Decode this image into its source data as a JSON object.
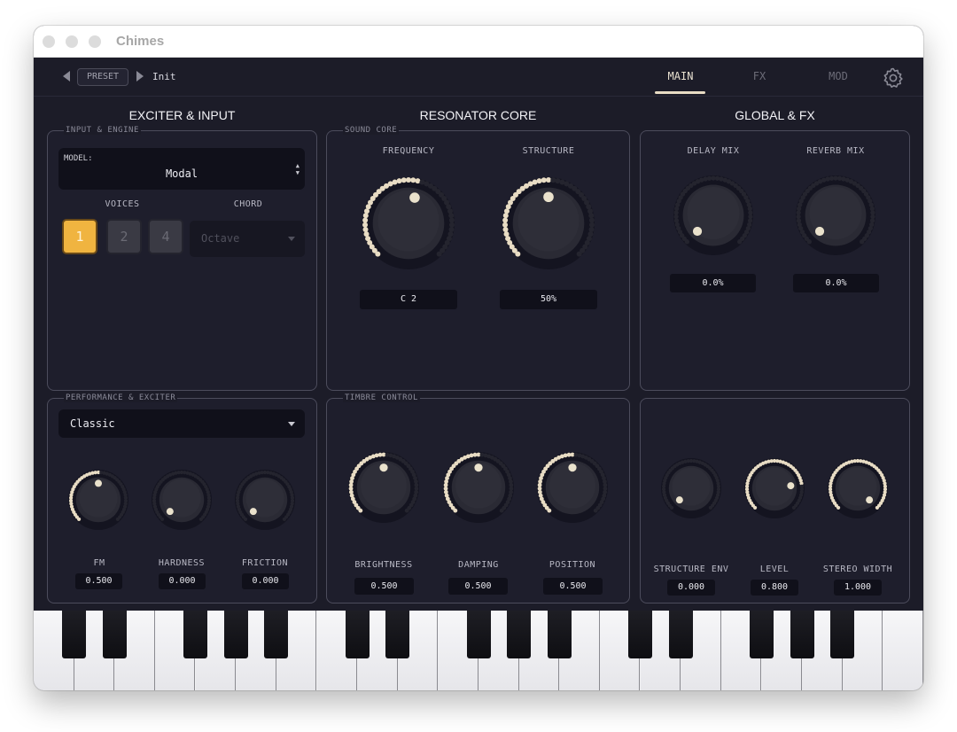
{
  "window": {
    "title": "Chimes"
  },
  "topbar": {
    "preset_button": "PRESET",
    "preset_name": "Init",
    "tabs": [
      {
        "label": "MAIN",
        "active": true
      },
      {
        "label": "FX",
        "active": false
      },
      {
        "label": "MOD",
        "active": false
      }
    ],
    "settings_icon": "gear-icon"
  },
  "columns": {
    "exciter": "EXCITER & INPUT",
    "resonator": "RESONATOR CORE",
    "global": "GLOBAL & FX"
  },
  "input_engine": {
    "section": "INPUT & ENGINE",
    "model_label": "MODEL:",
    "model_value": "Modal",
    "voices_label": "VOICES",
    "voices": [
      "1",
      "2",
      "4"
    ],
    "selected_voice": "1",
    "chord_label": "CHORD",
    "chord_value": "Octave"
  },
  "performance": {
    "section": "PERFORMANCE & EXCITER",
    "mode_value": "Classic",
    "knobs": [
      {
        "label": "FM",
        "value": "0.500",
        "level": 0.5
      },
      {
        "label": "HARDNESS",
        "value": "0.000",
        "level": 0.0
      },
      {
        "label": "FRICTION",
        "value": "0.000",
        "level": 0.0
      }
    ]
  },
  "sound_core": {
    "section": "SOUND CORE",
    "knobs": [
      {
        "label": "FREQUENCY",
        "value": "C 2",
        "level": 0.55
      },
      {
        "label": "STRUCTURE",
        "value": "50%",
        "level": 0.5
      }
    ]
  },
  "timbre": {
    "section": "TIMBRE CONTROL",
    "knobs": [
      {
        "label": "BRIGHTNESS",
        "value": "0.500",
        "level": 0.5
      },
      {
        "label": "DAMPING",
        "value": "0.500",
        "level": 0.5
      },
      {
        "label": "POSITION",
        "value": "0.500",
        "level": 0.5
      }
    ]
  },
  "global_fx": {
    "knobs": [
      {
        "label": "DELAY MIX",
        "value": "0.0%",
        "level": 0.0
      },
      {
        "label": "REVERB MIX",
        "value": "0.0%",
        "level": 0.0
      }
    ]
  },
  "global_bottom": {
    "knobs": [
      {
        "label": "STRUCTURE ENV",
        "value": "0.000",
        "level": 0.0
      },
      {
        "label": "LEVEL",
        "value": "0.800",
        "level": 0.8
      },
      {
        "label": "STEREO WIDTH",
        "value": "1.000",
        "level": 1.0
      }
    ]
  },
  "colors": {
    "accent": "#f0b440",
    "arc": "#e8dcc4",
    "background": "#1c1c28",
    "panel": "#1e1e2c"
  }
}
